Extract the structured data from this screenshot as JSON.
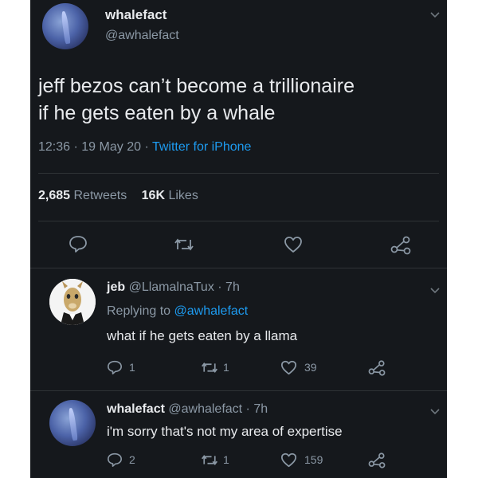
{
  "tweet": {
    "name": "whalefact",
    "handle": "@awhalefact",
    "text_line1": "jeff bezos can’t become a trillionaire",
    "text_line2": "if he gets eaten by a whale",
    "time": "12:36",
    "sep1": "·",
    "date": "19 May 20",
    "sep2": "·",
    "source": "Twitter for iPhone",
    "retweets_count": "2,685",
    "retweets_label": "Retweets",
    "likes_count": "16K",
    "likes_label": "Likes"
  },
  "reply1": {
    "name": "jeb",
    "handle": "@LlamalnaTux · 7h",
    "replying_prefix": "Replying to",
    "replying_to": "@awhalefact",
    "text": "what if he gets eaten by a llama",
    "reply_count": "1",
    "retweet_count": "1",
    "like_count": "39"
  },
  "reply2": {
    "name": "whalefact",
    "handle": "@awhalefact · 7h",
    "text": "i'm sorry that's not my area of expertise",
    "reply_count": "2",
    "retweet_count": "1",
    "like_count": "159"
  },
  "icons": {
    "reply": "comment-bubble-icon",
    "retweet": "retweet-arrows-icon",
    "like": "heart-icon",
    "share": "share-nodes-icon",
    "more": "chevron-down-icon"
  },
  "colors": {
    "background": "#15181c",
    "link": "#1d9bf0",
    "text": "#e8eaed",
    "muted": "#8b98a5"
  }
}
